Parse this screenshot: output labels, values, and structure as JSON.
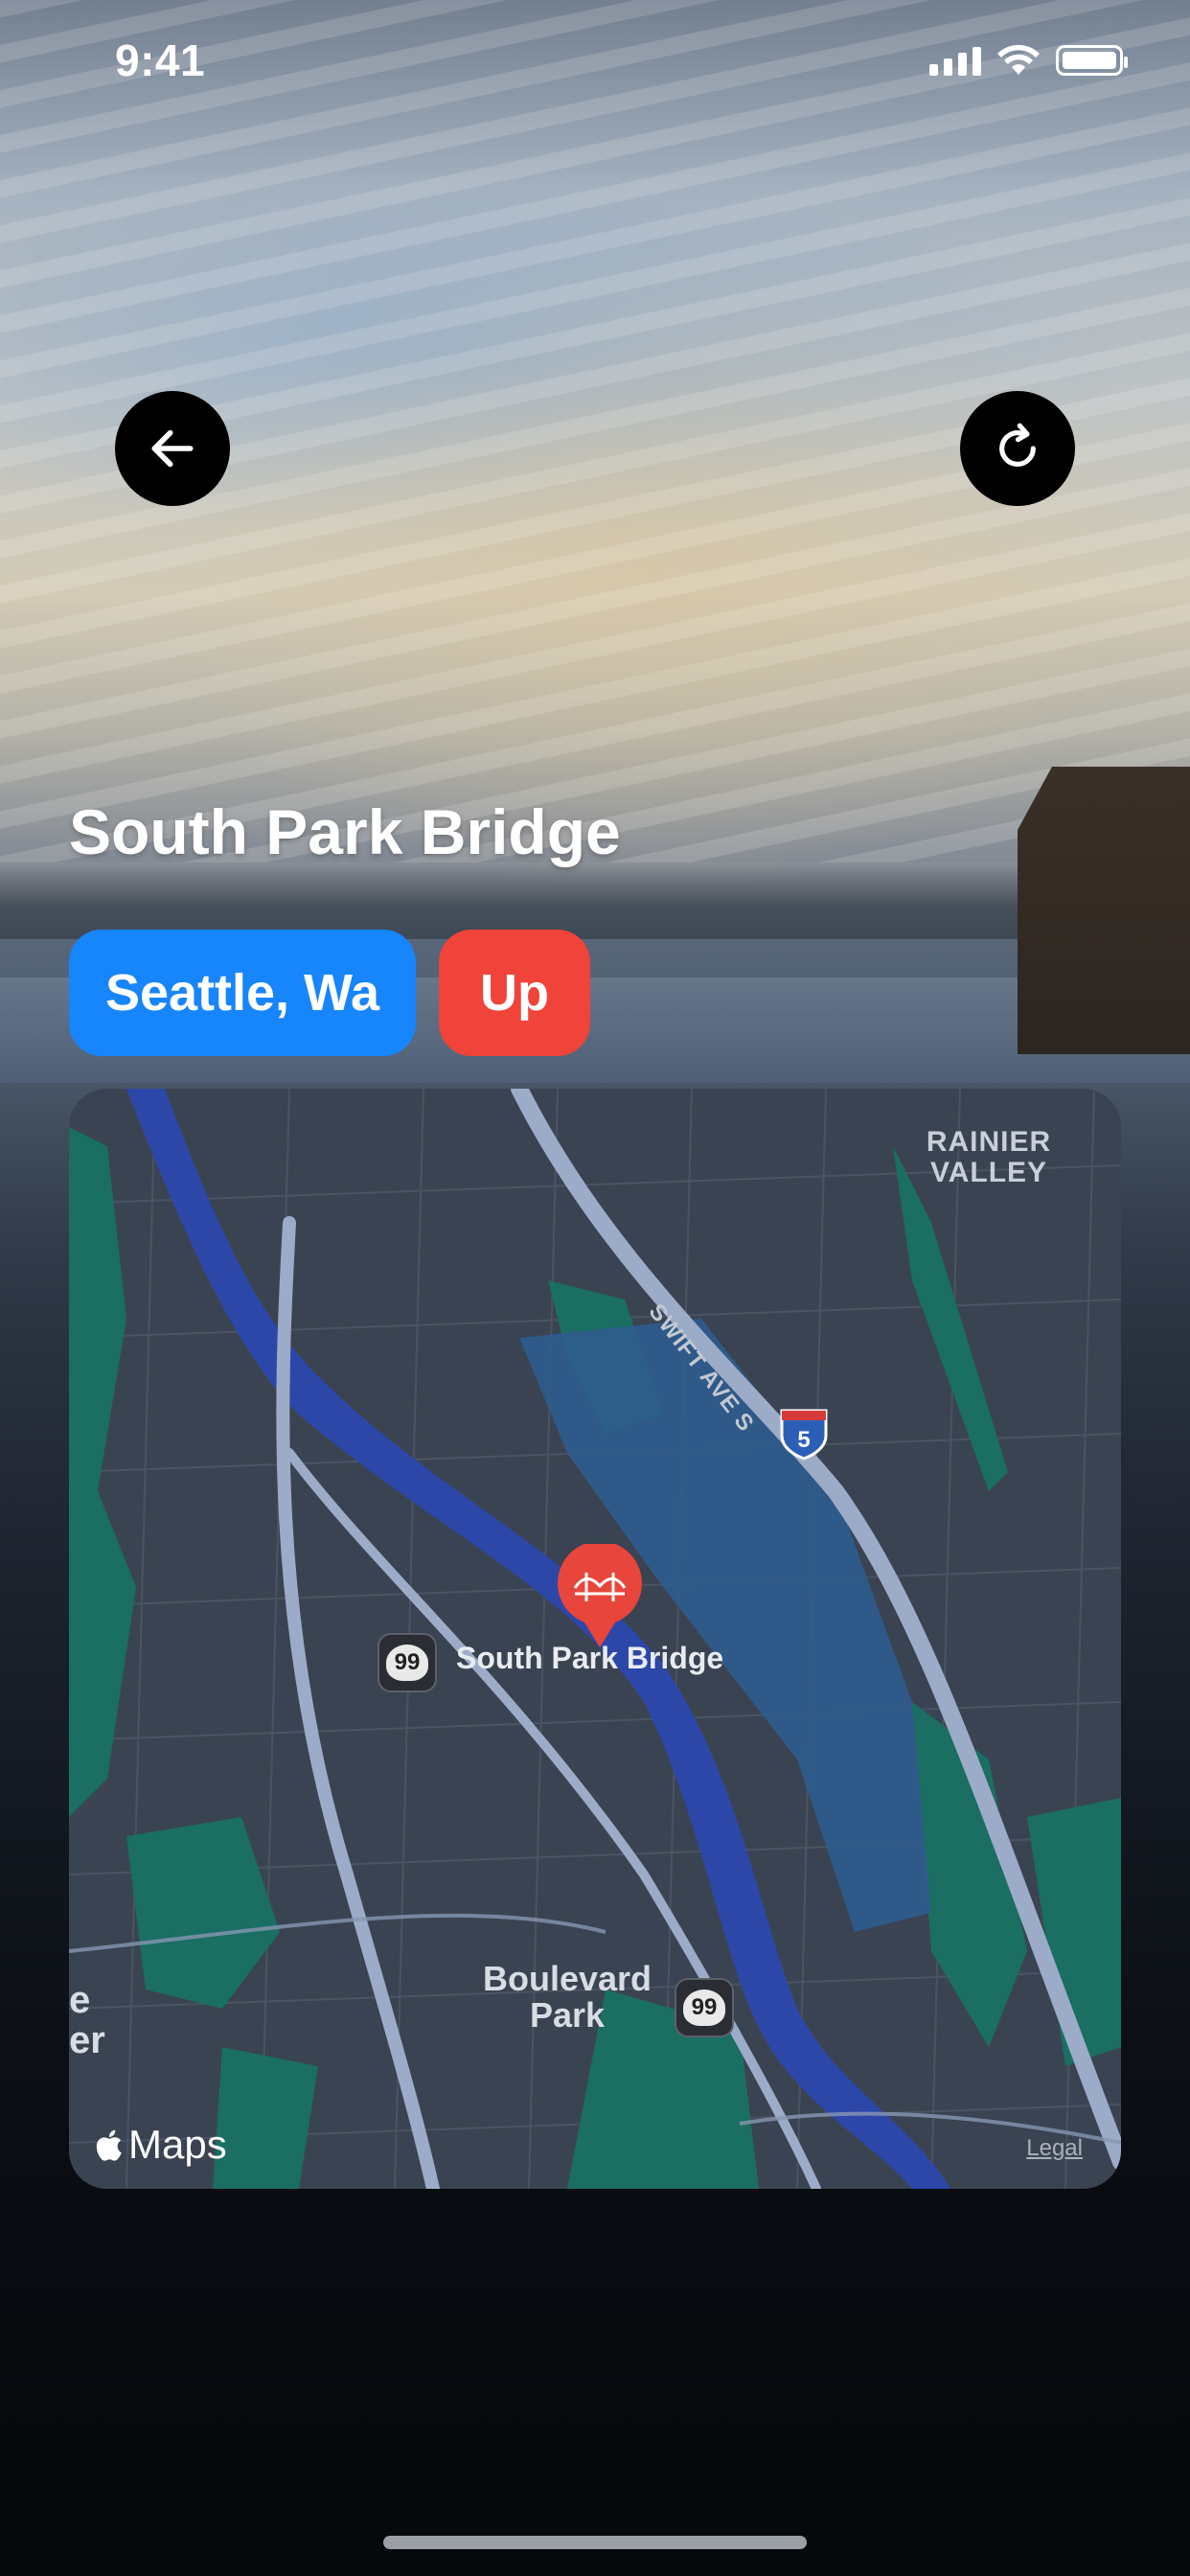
{
  "status_bar": {
    "time": "9:41"
  },
  "header": {
    "back_icon": "arrow-left-icon",
    "refresh_icon": "refresh-icon"
  },
  "bridge": {
    "name": "South Park Bridge",
    "location": "Seattle, Wa",
    "status": "Up",
    "status_color": "#f0433a",
    "location_color": "#1785fb"
  },
  "map": {
    "labels": {
      "area": "RAINIER VALLEY",
      "street": "SWIFT AVE S",
      "interstate": "5",
      "route_number": "99",
      "park": "Boulevard Park",
      "edge_partial": "e er",
      "pin_label": "South Park Bridge"
    },
    "brand": "Maps",
    "legal": "Legal"
  }
}
